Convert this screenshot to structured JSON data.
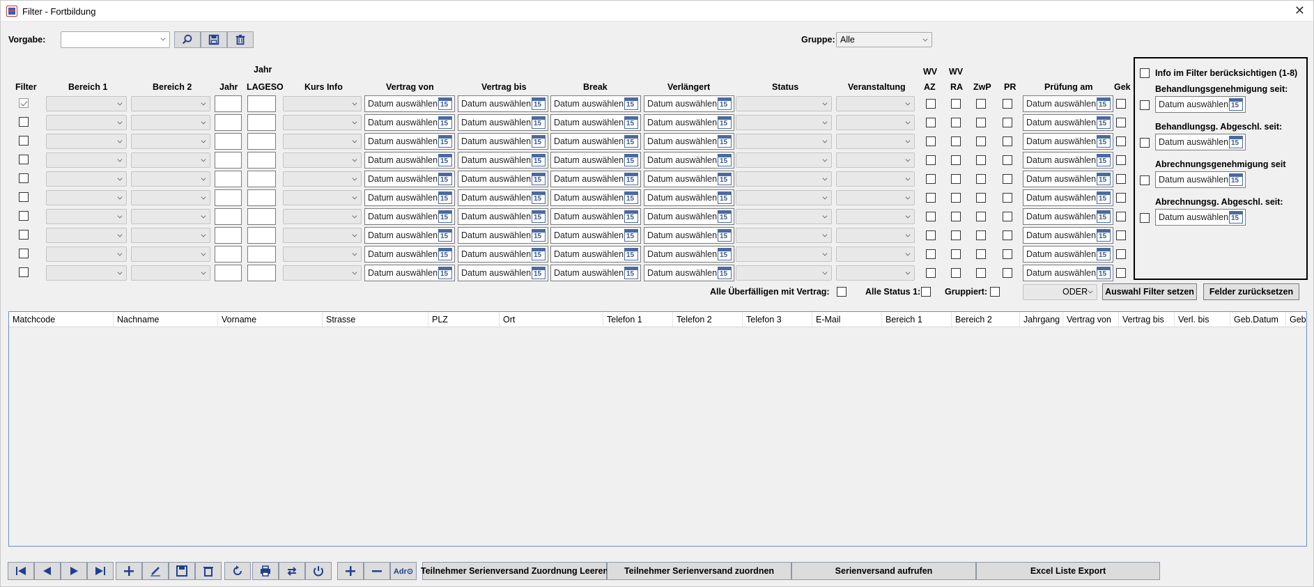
{
  "window": {
    "title": "Filter - Fortbildung"
  },
  "toolbar": {
    "vorgabe_label": "Vorgabe:",
    "vorgabe_value": "",
    "gruppe_label": "Gruppe:",
    "gruppe_value": "Alle"
  },
  "columns": {
    "filter": "Filter",
    "bereich1": "Bereich 1",
    "bereich2": "Bereich 2",
    "jahr": "Jahr",
    "jahr_top": "Jahr",
    "lageso": "LAGESO",
    "kurs_info": "Kurs Info",
    "vertrag_von": "Vertrag von",
    "vertrag_bis": "Vertrag bis",
    "break": "Break",
    "verlaengert": "Verlängert",
    "status": "Status",
    "veranstaltung": "Veranstaltung",
    "wv1": "WV",
    "az": "AZ",
    "wv2": "WV",
    "ra": "RA",
    "zwp": "ZwP",
    "pr": "PR",
    "pruefung_am": "Prüfung am",
    "gek": "Gek"
  },
  "date_placeholder": "Datum auswählen",
  "calendar_day": "15",
  "rows_first_checked": true,
  "info_panel": {
    "header": "Info im Filter berücksichtigen (1-8)",
    "items": [
      "Behandlungsgenehmigung seit:",
      "Behandlungsg. Abgeschl. seit:",
      "Abrechnungsgenehmigung seit",
      "Abrechnungsg. Abgeschl. seit:"
    ]
  },
  "options": {
    "alle_ueberfaelligen": "Alle Überfälligen mit Vertrag:",
    "alle_status1": "Alle Status 1:",
    "gruppiert": "Gruppiert:",
    "operator": "ODER",
    "apply_button": "Auswahl Filter setzen",
    "reset_button": "Felder zurücksetzen"
  },
  "grid_columns": [
    "Matchcode",
    "Nachname",
    "Vorname",
    "Strasse",
    "PLZ",
    "Ort",
    "Telefon 1",
    "Telefon 2",
    "Telefon 3",
    "E-Mail",
    "Bereich 1",
    "Bereich 2",
    "Jahrgang",
    "Vertrag von",
    "Vertrag bis",
    "Verl. bis",
    "Geb.Datum",
    "Geb.G"
  ],
  "bottom": {
    "adr_label": "Adr⊙",
    "btn1": "Teilnehmer Serienversand Zuordnung Leeren",
    "btn2": "Teilnehmer Serienversand zuordnen",
    "btn3": "Serienversand aufrufen",
    "btn4": "Excel Liste Export"
  },
  "colors": {
    "accent": "#1f3f8f",
    "grid_border": "#6e8fbf"
  }
}
